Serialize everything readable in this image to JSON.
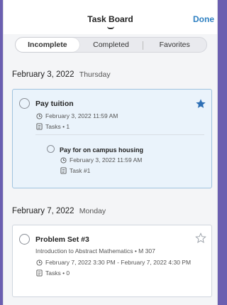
{
  "header": {
    "title": "Task Board",
    "done_label": "Done"
  },
  "tabs": [
    {
      "label": "Incomplete",
      "active": true
    },
    {
      "label": "Completed",
      "active": false
    },
    {
      "label": "Favorites",
      "active": false
    }
  ],
  "sections": [
    {
      "date": "February 3, 2022",
      "day": "Thursday",
      "card": {
        "title": "Pay tuition",
        "favorite": true,
        "datetime": "February 3, 2022 11:59 AM",
        "tasks": "Tasks • 1",
        "subtask": {
          "title": "Pay for on campus housing",
          "datetime": "February 3, 2022 11:59 AM",
          "tasks": "Task #1"
        }
      }
    },
    {
      "date": "February 7, 2022",
      "day": "Monday",
      "card": {
        "title": "Problem Set #3",
        "favorite": false,
        "course": "Introduction to Abstract Mathematics • M 307",
        "datetime": "February 7, 2022 3:30 PM - February 7, 2022 4:30 PM",
        "tasks": "Tasks • 0"
      }
    }
  ],
  "colors": {
    "accent": "#2d7fc1",
    "selected_card": "#eaf3fb",
    "frame": "#6b5fb0"
  },
  "icons": {
    "clock": "clock-icon",
    "tasks": "checklist-icon",
    "favorite_on": "star-filled-icon",
    "favorite_off": "star-outline-icon"
  }
}
